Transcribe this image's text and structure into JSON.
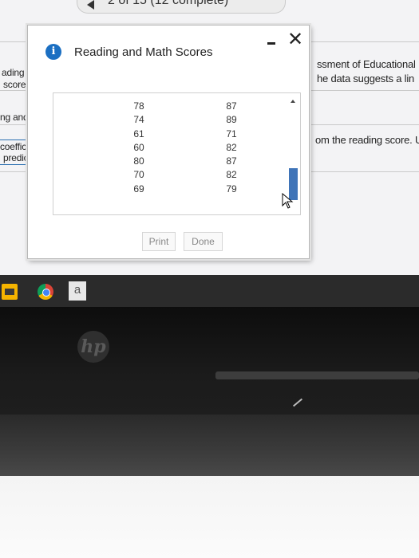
{
  "background_page": {
    "top_tab_text": "2 of 15 (12 complete)",
    "left_snippets": [
      "ading a",
      "scored",
      "ng and t",
      "coefficien",
      "predicted"
    ],
    "right_snippets": [
      "ssment of Educational",
      "he data suggests a lin",
      "om the reading score. U"
    ]
  },
  "dialog": {
    "title": "Reading and Math Scores",
    "close_symbol": "✕",
    "columns": {
      "reading": [
        78,
        74,
        61,
        60,
        80,
        70,
        69
      ],
      "math": [
        87,
        89,
        71,
        82,
        87,
        82,
        79
      ]
    },
    "print_label": "Print",
    "done_label": "Done"
  },
  "taskbar": {
    "app_letter": "a"
  },
  "hardware": {
    "logo_text": "hp"
  },
  "colors": {
    "info_icon": "#1b6fc2",
    "scroll_thumb": "#3f74b8"
  }
}
